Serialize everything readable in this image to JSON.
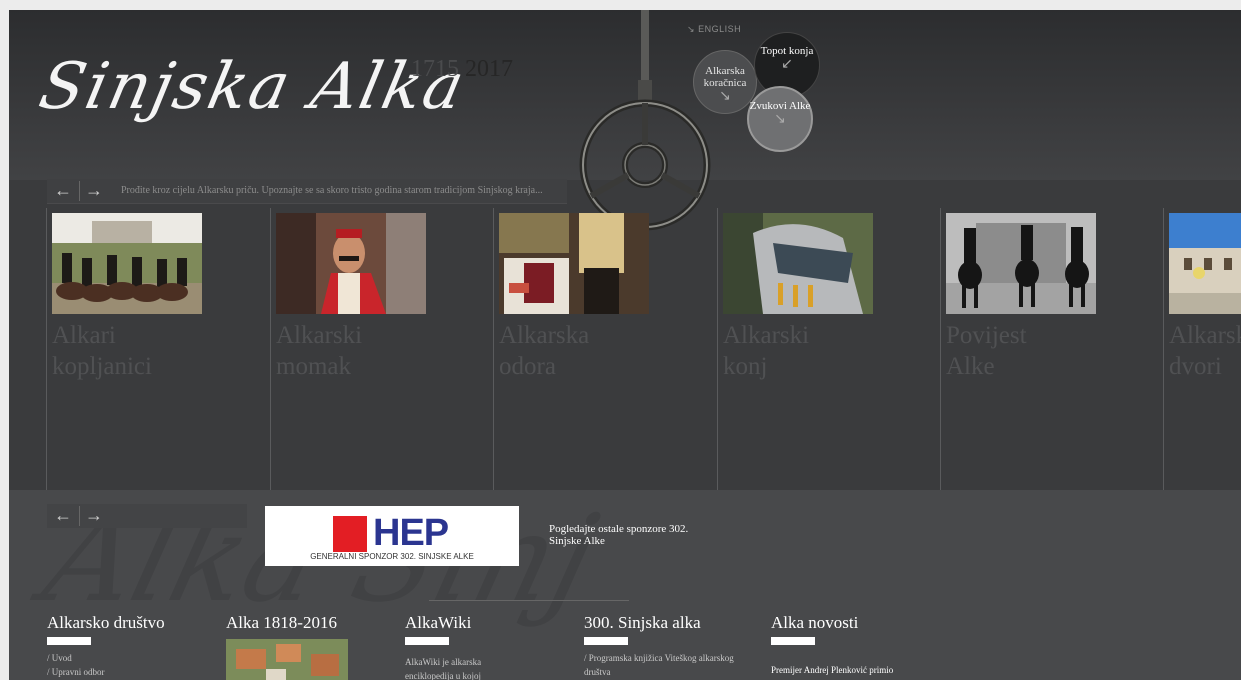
{
  "header": {
    "logo_text": "Sinjska Alka",
    "year_start": "1715",
    "year_end": "2017",
    "lang_link": "ENGLISH",
    "bubbles": [
      {
        "label": "Alkarska koračnica"
      },
      {
        "label": "Topot konja"
      },
      {
        "label": "Zvukovi Alke"
      }
    ]
  },
  "story": {
    "prev_label": "←",
    "next_label": "→",
    "text": "Prođite kroz cijelu Alkarsku priču. Upoznajte se sa skoro tristo godina starom tradicijom Sinjskog kraja..."
  },
  "cards": [
    {
      "title_1": "Alkari",
      "title_2": "kopljanici"
    },
    {
      "title_1": "Alkarski",
      "title_2": "momak"
    },
    {
      "title_1": "Alkarska",
      "title_2": "odora"
    },
    {
      "title_1": "Alkarski",
      "title_2": "konj"
    },
    {
      "title_1": "Povijest",
      "title_2": "Alke"
    },
    {
      "title_1": "Alkarski",
      "title_2": "dvori"
    }
  ],
  "sponsor": {
    "prev_label": "←",
    "next_label": "→",
    "logo_text": "HEP",
    "logo_sub": "GENERALNI SPONZOR 302. SINJSKE ALKE",
    "text": "Pogledajte ostale sponzore 302. Sinjske Alke"
  },
  "footer": {
    "col1": {
      "heading": "Alkarsko društvo",
      "links": [
        "/ Uvod",
        "/ Upravni odbor"
      ]
    },
    "col2": {
      "heading": "Alka 1818-2016"
    },
    "col3": {
      "heading": "AlkaWiki",
      "text": "AlkaWiki je alkarska",
      "text2": "enciklopedija u kojoj"
    },
    "col4": {
      "heading": "300. Sinjska alka",
      "links": [
        "/ Programska knjižica Viteškog alkarskog",
        "društva"
      ]
    },
    "col5": {
      "heading": "Alka novosti",
      "text": "Premijer Andrej Plenković primio"
    }
  },
  "colors": {
    "background": "#3a3b3d",
    "lower": "#48494b",
    "hep_blue": "#2b3590",
    "hep_red": "#e31e24"
  }
}
